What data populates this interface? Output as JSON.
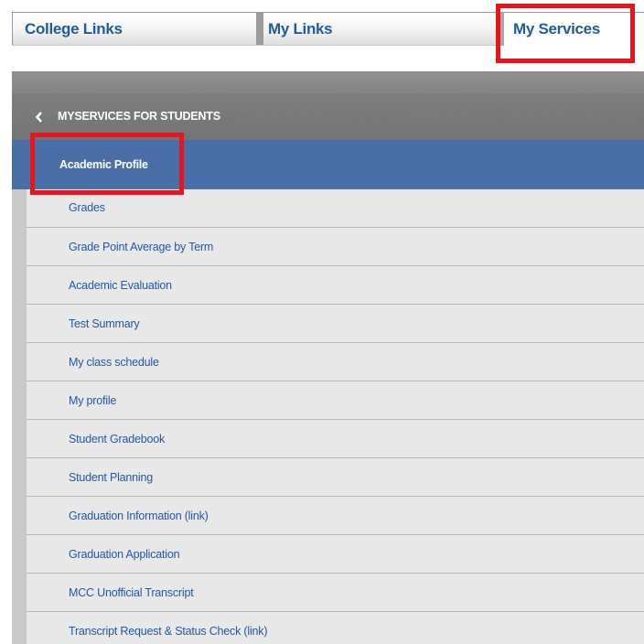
{
  "tabs": {
    "college_links": "College Links",
    "my_links": "My Links",
    "my_services": "My Services"
  },
  "panel": {
    "title": "MYSERVICES FOR STUDENTS",
    "back_icon": "chevron-left-icon",
    "selected_item": "Academic Profile",
    "items": [
      "Grades",
      "Grade Point Average by Term",
      "Academic Evaluation",
      "Test Summary",
      "My class schedule",
      "My profile",
      "Student Gradebook",
      "Student Planning",
      "Graduation Information (link)",
      "Graduation Application",
      "MCC Unofficial Transcript",
      "Transcript Request & Status Check (link)"
    ]
  },
  "colors": {
    "tab_text": "#1f5c99",
    "header_bg": "#7a7a7a",
    "selected_bg": "#4a6fa8",
    "link_text": "#2158a6",
    "list_bg": "#e8e8e8",
    "highlight": "#e8141c"
  }
}
